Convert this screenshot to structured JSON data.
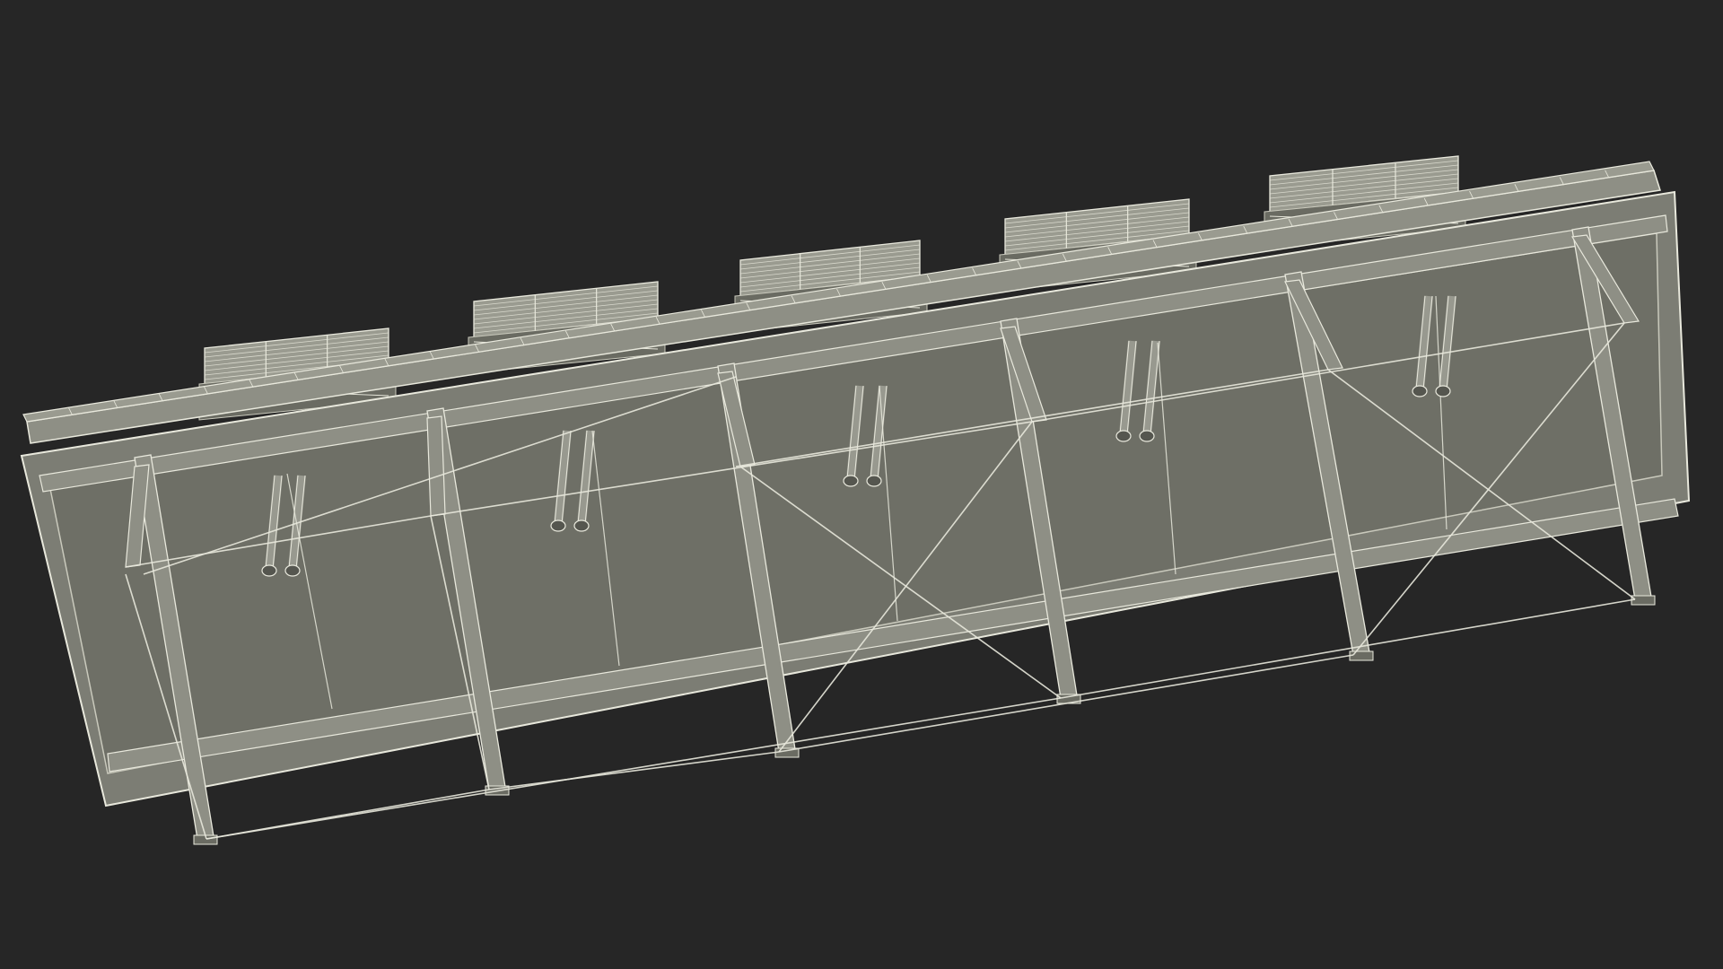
{
  "scene": {
    "subject": "cooling-tower-wireframe-render",
    "unit_count": 5,
    "colors": {
      "background": "#262626",
      "panel_fill": "#6e6f66",
      "panel_fill_light": "#7a7b72",
      "frame_fill": "#8e8f85",
      "frame_fill_dark": "#6a6b62",
      "wire": "#e8e8dc",
      "wire_dim": "#c9c9bc",
      "grille_fill": "#9a9b90"
    }
  }
}
